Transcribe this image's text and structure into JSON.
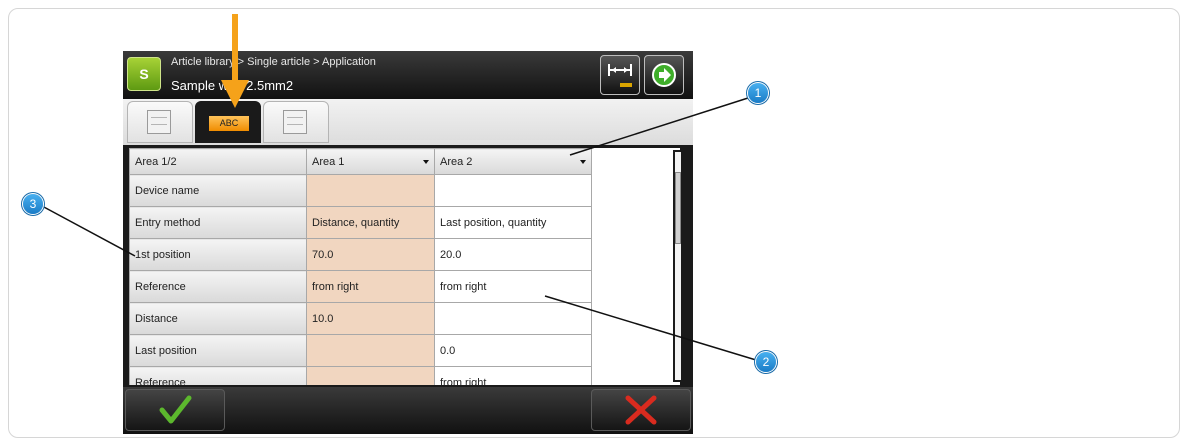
{
  "header": {
    "logo_label": "S",
    "breadcrumb": "Article library > Single article > Application",
    "title": "Sample wire 2.5mm2",
    "width_icon": "width-adjust-icon",
    "next_icon": "arrow-right-circle-icon"
  },
  "tabs": [
    {
      "name": "page-list",
      "icon": "page-icon"
    },
    {
      "name": "abc",
      "label": "ABC",
      "active": true
    },
    {
      "name": "page-detail",
      "icon": "page-icon"
    }
  ],
  "table": {
    "columns": [
      "Area 1/2",
      "Area 1",
      "Area 2"
    ],
    "rows": [
      {
        "label": "Device name",
        "area1": "",
        "area2": ""
      },
      {
        "label": "Entry method",
        "area1": "Distance, quantity",
        "area2": "Last position, quantity"
      },
      {
        "label": "1st position",
        "area1": "70.0",
        "area2": "20.0"
      },
      {
        "label": "Reference",
        "area1": "from right",
        "area2": "from right"
      },
      {
        "label": "Distance",
        "area1": "10.0",
        "area2": ""
      },
      {
        "label": "Last position",
        "area1": "",
        "area2": "0.0"
      },
      {
        "label": "Reference",
        "area1": "",
        "area2": "from right"
      }
    ]
  },
  "footer": {
    "ok_icon": "checkmark-icon",
    "cancel_icon": "cross-icon"
  },
  "callouts": [
    "1",
    "2",
    "3"
  ],
  "colors": {
    "accent_orange": "#f5a21a",
    "logo_green": "#7cb518",
    "edited_cell": "#f1d6c0",
    "callout_blue": "#2e8fd6",
    "ok_green": "#5cb82d",
    "cancel_red": "#d92b1f"
  }
}
